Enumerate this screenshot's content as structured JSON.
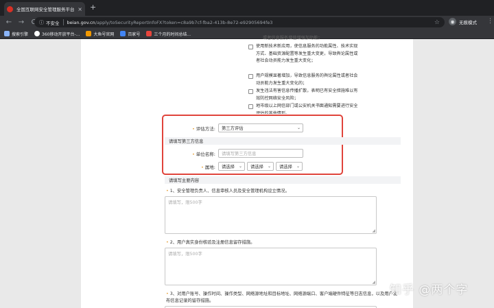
{
  "browser": {
    "tab_title": "全国互联网安全管理服务平台",
    "tab_close": "×",
    "new_tab": "+",
    "nav": {
      "back": "←",
      "forward": "→",
      "reload": "C"
    },
    "security_label": "不安全",
    "url_host": "beian.gov.cn",
    "url_path": "/apply/toSecurityReportInfoFX?token=c8a9b7cf-fba2-413b-8e72-e92905694fe3",
    "profile_label": "无痕模式",
    "bookmarks": [
      {
        "label": "搜索引擎",
        "color": "#8ab4f8"
      },
      {
        "label": "360移动开放平台-...",
        "color": "#ffffff"
      },
      {
        "label": "大鱼号官网",
        "color": "#f29900"
      },
      {
        "label": "百家号",
        "color": "#4285f4"
      },
      {
        "label": "三个月的时间总结...",
        "color": "#e8453c"
      }
    ]
  },
  "checkboxes": [
    {
      "text": "或者信息服务增值增强加功能；",
      "checked": false
    },
    {
      "text": "使用新技术新应用，使信息服务的功能属性、技术实现方式、基础资源配置等发生重大变更，导致舆论属性或者社会动员能力发生重大变化；",
      "checked": false
    },
    {
      "text": "用户规模显著增加，导致信息服务的舆论属性或者社会动员能力发生重大变化的；",
      "checked": false
    },
    {
      "text": "发生违法有害信息传播扩散，表明已有安全措施难以有效防控网络安全风险；",
      "checked": false
    },
    {
      "text": "地市级以上网信部门或公安机关书面通知需要进行安全评估的其他情形。",
      "checked": false
    }
  ],
  "eval": {
    "label": "评估方法:",
    "value": "第三方评估"
  },
  "third_party": {
    "section_title": "请填写第三方信息",
    "unit_label": "单位名称:",
    "unit_placeholder": "请填写第三方信息",
    "region_label": "属地:",
    "region_selects": [
      "请选择",
      "请选择",
      "请选择"
    ]
  },
  "main_content": {
    "section_title": "请填写主要内容",
    "questions": [
      {
        "title": "1、安全管理负责人、信息审核人员及安全管理机构设立情况。",
        "placeholder": "请填写，限500字"
      },
      {
        "title": "2、用户真实身份核验及注册信息留存措施。",
        "placeholder": "请填写，限500字"
      },
      {
        "title": "3、对用户账号、操作时间、操作类型、网络源地址和目标地址、网络源端口、客户端硬件特征等日志信息，以及用户发布信息记录的留存措施。",
        "placeholder": ""
      }
    ]
  },
  "watermark": "知乎 @两个字"
}
